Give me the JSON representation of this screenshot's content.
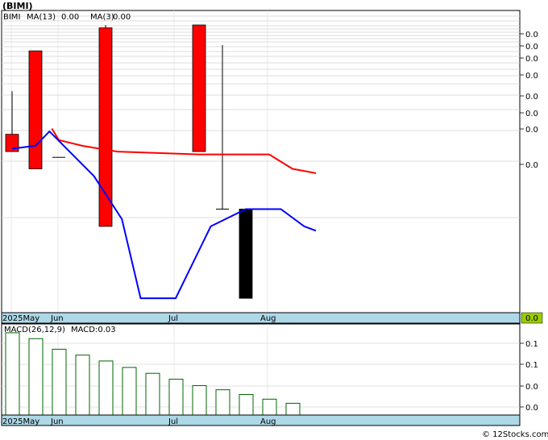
{
  "title": "(BIMI)",
  "watermark": "© 12Stocks.com",
  "colors": {
    "up": "#ff0000",
    "down": "#000000",
    "ma13": "#ff0000",
    "ma3": "#0000ff",
    "macd_bar": "#006400",
    "axis_band": "#add8e6",
    "last_box": "#99cc00",
    "grid": "#cccccc"
  },
  "chart_data": [
    {
      "type": "candlestick",
      "ticker": "BIMI",
      "legend": {
        "ticker": "BIMI",
        "ma13_label": "MA(13)",
        "ma13_value": "0.00",
        "ma3_label": "MA(3)",
        "ma3_value": "0.00"
      },
      "x_labels": [
        "2025May",
        "Jun",
        "Jul",
        "Aug"
      ],
      "y_tick_labels": [
        "0.0",
        "0.0",
        "0.0",
        "0.0",
        "0.0",
        "0.0",
        "0.0",
        "0.0",
        "0.0"
      ],
      "last_value_label": "0.0",
      "ylim": [
        0,
        1
      ],
      "candles": [
        {
          "x": 0,
          "open": 0.12,
          "close": 0.24,
          "high": 0.54,
          "low": 0.24,
          "color": "up"
        },
        {
          "x": 1,
          "open": 0.0,
          "close": 0.82,
          "high": 0.82,
          "low": 0.0,
          "color": "up"
        },
        {
          "x": 2,
          "open": 0.08,
          "close": 0.08,
          "high": 0.08,
          "low": 0.08,
          "color": "down"
        },
        {
          "x": 4,
          "open": -0.4,
          "close": 0.98,
          "high": 1.0,
          "low": -0.4,
          "color": "up"
        },
        {
          "x": 8,
          "open": 0.12,
          "close": 1.0,
          "high": 1.0,
          "low": 0.12,
          "color": "up"
        },
        {
          "x": 9,
          "open": -0.28,
          "close": -0.28,
          "high": 0.86,
          "low": -0.28,
          "color": "down"
        },
        {
          "x": 10,
          "open": -0.9,
          "close": -0.28,
          "high": -0.28,
          "low": -0.9,
          "color": "down"
        }
      ],
      "ma13": [
        {
          "x": 1.7,
          "y": 0.28
        },
        {
          "x": 2.0,
          "y": 0.2
        },
        {
          "x": 3.0,
          "y": 0.16
        },
        {
          "x": 4.5,
          "y": 0.12
        },
        {
          "x": 8.0,
          "y": 0.1
        },
        {
          "x": 11.0,
          "y": 0.1
        },
        {
          "x": 12.0,
          "y": 0.0
        },
        {
          "x": 13.0,
          "y": -0.03
        }
      ],
      "ma3": [
        {
          "x": 0.0,
          "y": 0.14
        },
        {
          "x": 1.0,
          "y": 0.16
        },
        {
          "x": 1.6,
          "y": 0.26
        },
        {
          "x": 3.5,
          "y": -0.05
        },
        {
          "x": 4.7,
          "y": -0.35
        },
        {
          "x": 5.5,
          "y": -0.9
        },
        {
          "x": 7.0,
          "y": -0.9
        },
        {
          "x": 8.5,
          "y": -0.4
        },
        {
          "x": 10.0,
          "y": -0.28
        },
        {
          "x": 11.5,
          "y": -0.28
        },
        {
          "x": 12.5,
          "y": -0.4
        },
        {
          "x": 13.0,
          "y": -0.43
        }
      ]
    },
    {
      "type": "bar",
      "legend": {
        "macd_label": "MACD(26,12,9)",
        "macd_value_label": "MACD:0.03"
      },
      "x_labels": [
        "2025May",
        "Jun",
        "Jul",
        "Aug"
      ],
      "y_tick_labels": [
        "0.1",
        "0.1",
        "0.1",
        "0.0",
        "0.0"
      ],
      "values": [
        0.125,
        0.115,
        0.097,
        0.087,
        0.077,
        0.066,
        0.056,
        0.046,
        0.035,
        0.028,
        0.02,
        0.012,
        0.005
      ],
      "ylim": [
        -0.015,
        0.14
      ]
    }
  ]
}
